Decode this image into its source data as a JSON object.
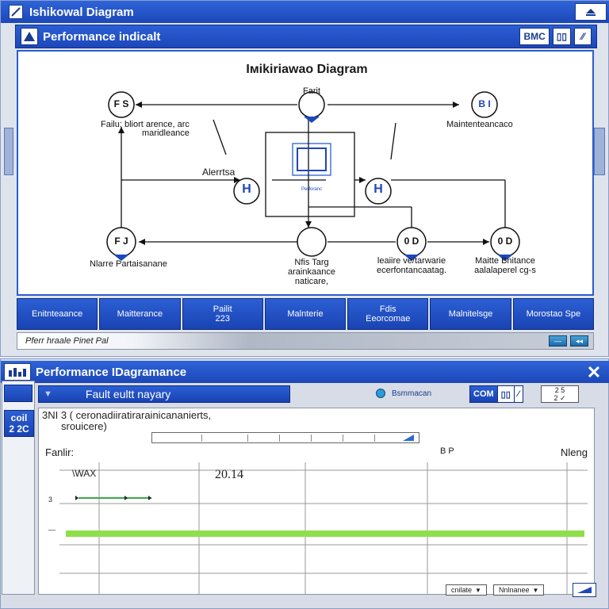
{
  "top_window": {
    "title": "Ishikowal Diagram",
    "panel_title": "Performance indicalt",
    "panel_buttons": [
      "BMC",
      "▯▯",
      "⁄⁄"
    ],
    "diagram_title": "Iмikiriawao Diagram",
    "nodes": {
      "top_left": {
        "symbol": "F S",
        "label_lines": [
          "Failu: bliort arence, arc",
          "maridleance"
        ]
      },
      "top_center": {
        "symbol": "Farit",
        "label_lines": []
      },
      "top_right": {
        "symbol": "B I",
        "label_lines": [
          "Maintenteancaco"
        ]
      },
      "mid_left": {
        "symbol": "H",
        "label_lines": [
          "Alerrtsa"
        ]
      },
      "mid_right": {
        "symbol": "H",
        "label_lines": []
      },
      "box_caption": "Perforanc",
      "bot_left": {
        "symbol": "F J",
        "label_lines": [
          "Nlarre Partaisanane"
        ]
      },
      "bot_center": {
        "symbol": "",
        "label_lines": [
          "Nfis Targ",
          "arainkaance",
          "naticare,"
        ]
      },
      "bot_cright": {
        "symbol": "0 D",
        "label_lines": [
          "leaiire ve/tarwarie",
          "ecerfontancaatag."
        ]
      },
      "bot_right": {
        "symbol": "0 D",
        "label_lines": [
          "Maitte Bnitance",
          "aalalaperel cg-s"
        ]
      }
    },
    "tabs": [
      "Enitnteaance",
      "Maitterance",
      "Pailit\n223",
      "Malnterie",
      "Fdis\nEeorcomae",
      "Malnitelsge",
      "Morostao Spe"
    ],
    "status_text": "Pferr hraale Pinet  Pal",
    "status_buttons": [
      "—",
      "◂◂"
    ]
  },
  "bottom_window": {
    "title": "Performance IDagramance",
    "left_badge": "coil\n2 2C",
    "fault_bar_label": "Fault eultt nayary",
    "summary_link": "Bsmmacan",
    "cond_buttons": [
      "COM",
      "▯▯",
      "⁄"
    ],
    "mini_box": "2 5\n2 ✓",
    "description_line1": "3NI 3 (   ceronadiiratirarainicananierts,",
    "description_line2": "srouicere)",
    "chart_left_label": "Fanlir:",
    "chart_mid_label": "B   P",
    "chart_right_label": "Nleng",
    "bottom_buttons": [
      "cnilate",
      "Nnlnanee"
    ]
  },
  "colors": {
    "titlebar": "#2354cc",
    "accent_blue": "#1d47ba",
    "bar_green": "#8ee04a",
    "line_green": "#3aa84a"
  },
  "chart_data": {
    "type": "line",
    "title": "",
    "annotations": [
      "\\WAX",
      "20.14"
    ],
    "y_tick_labels": [
      "3",
      "—"
    ],
    "series": [
      {
        "values": [
          2,
          2
        ]
      },
      {
        "values": [
          1,
          1
        ]
      }
    ],
    "x": [
      0,
      1
    ],
    "grid": true
  }
}
